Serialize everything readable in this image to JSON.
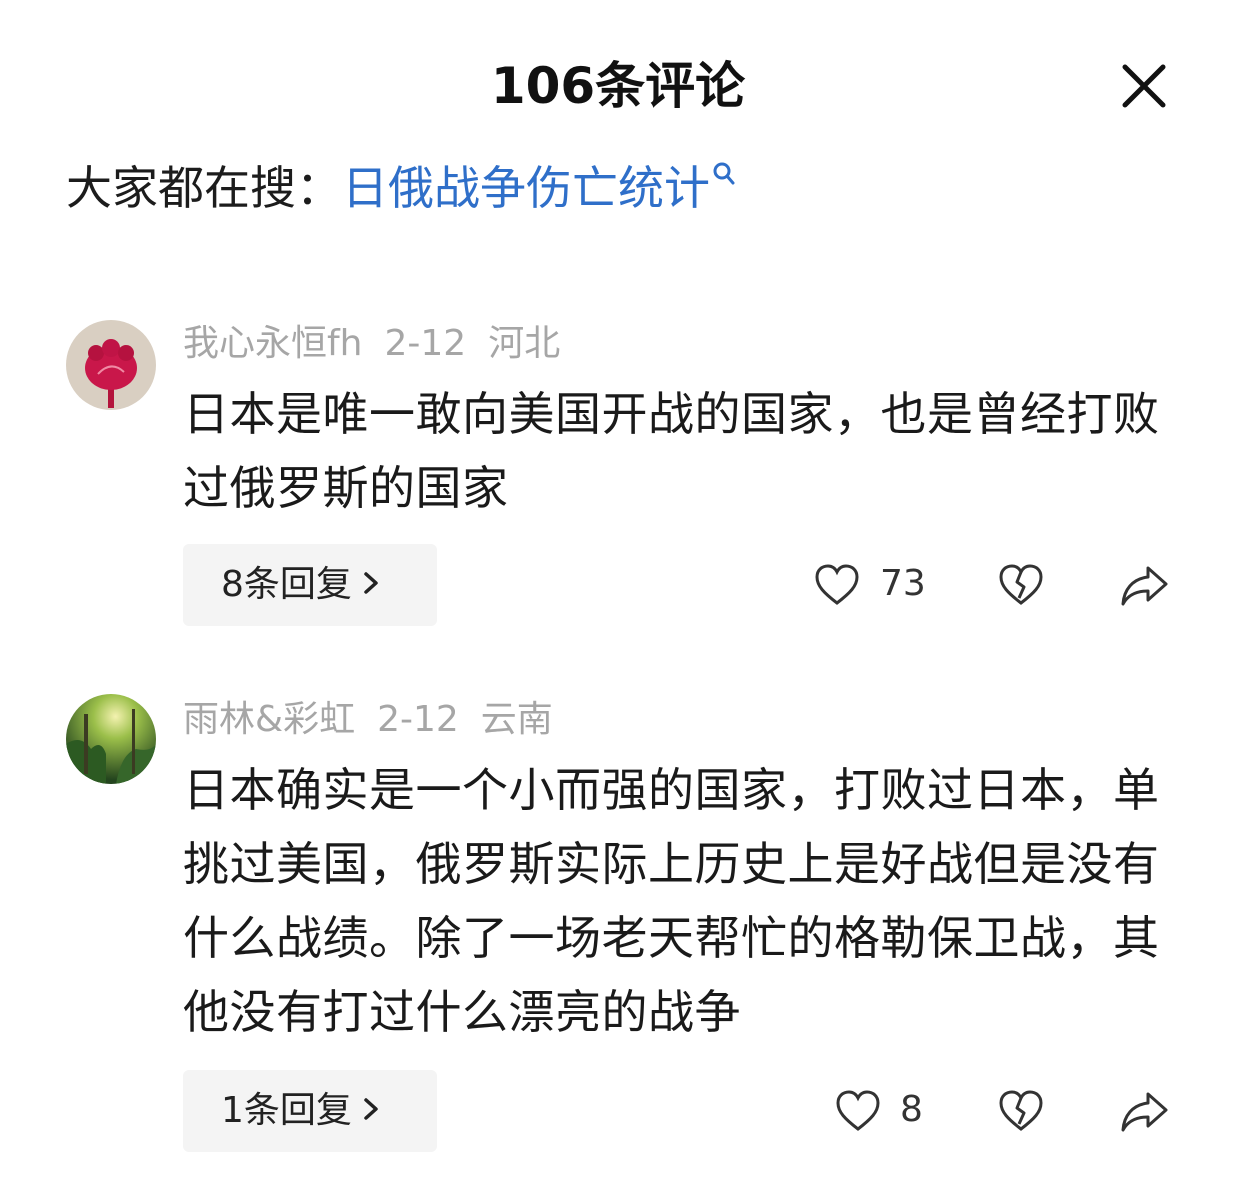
{
  "header": {
    "title": "106条评论"
  },
  "hot_search": {
    "prefix": "大家都在搜：",
    "term": "日俄战争伤亡统计",
    "icon": "search-icon",
    "link_color": "#2f6fc9"
  },
  "comments": [
    {
      "username": "我心永恒fh",
      "date": "2-12",
      "location": "河北",
      "text": "日本是唯一敢向美国开战的国家，也是曾经打败过俄罗斯的国家",
      "replies_label": "8条回复",
      "likes": "73",
      "avatar": "flower-avatar"
    },
    {
      "username": "雨林&彩虹",
      "date": "2-12",
      "location": "云南",
      "text": "日本确实是一个小而强的国家，打败过日本，单挑过美国，俄罗斯实际上历史上是好战但是没有什么战绩。除了一场老天帮忙的格勒保卫战，其他没有打过什么漂亮的战争",
      "replies_label": "1条回复",
      "likes": "8",
      "avatar": "forest-avatar"
    }
  ]
}
